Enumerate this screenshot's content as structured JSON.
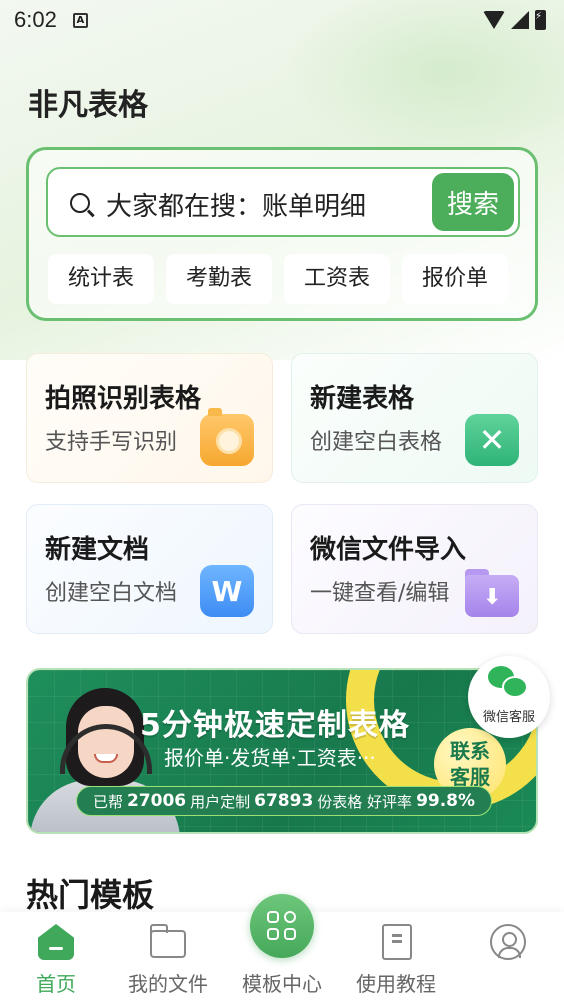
{
  "status_bar": {
    "time": "6:02",
    "indicator": "A"
  },
  "app": {
    "title": "非凡表格"
  },
  "search": {
    "placeholder": "大家都在搜：账单明细",
    "button_label": "搜索",
    "chips": [
      "统计表",
      "考勤表",
      "工资表",
      "报价单"
    ]
  },
  "actions": [
    {
      "title": "拍照识别表格",
      "subtitle": "支持手写识别",
      "icon": "camera-icon"
    },
    {
      "title": "新建表格",
      "subtitle": "创建空白表格",
      "icon": "excel-icon",
      "glyph": "✕"
    },
    {
      "title": "新建文档",
      "subtitle": "创建空白文档",
      "icon": "word-icon",
      "glyph": "W"
    },
    {
      "title": "微信文件导入",
      "subtitle": "一键查看/编辑",
      "icon": "folder-import-icon",
      "glyph": "⬇"
    }
  ],
  "banner": {
    "title": "5分钟极速定制表格",
    "subtitle": "报价单·发货单·工资表···",
    "contact_line1": "联系",
    "contact_line2": "客服",
    "stats": {
      "prefix": "已帮",
      "users": "27006",
      "users_suffix": "用户定制",
      "tables": "67893",
      "tables_suffix": "份表格 好评率",
      "rating": "99.8%"
    }
  },
  "wechat_service": {
    "label": "微信客服"
  },
  "hot_templates": {
    "title": "热门模板"
  },
  "bottom_nav": {
    "items": [
      {
        "label": "首页",
        "icon": "home-icon",
        "active": true
      },
      {
        "label": "我的文件",
        "icon": "folder-icon"
      },
      {
        "label": "模板中心",
        "icon": "grid-icon"
      },
      {
        "label": "使用教程",
        "icon": "book-icon"
      },
      {
        "label": "",
        "icon": "user-icon"
      }
    ]
  },
  "colors": {
    "accent": "#4cae5a",
    "banner_green": "#1a8a55",
    "highlight_yellow": "#ffe54a"
  }
}
